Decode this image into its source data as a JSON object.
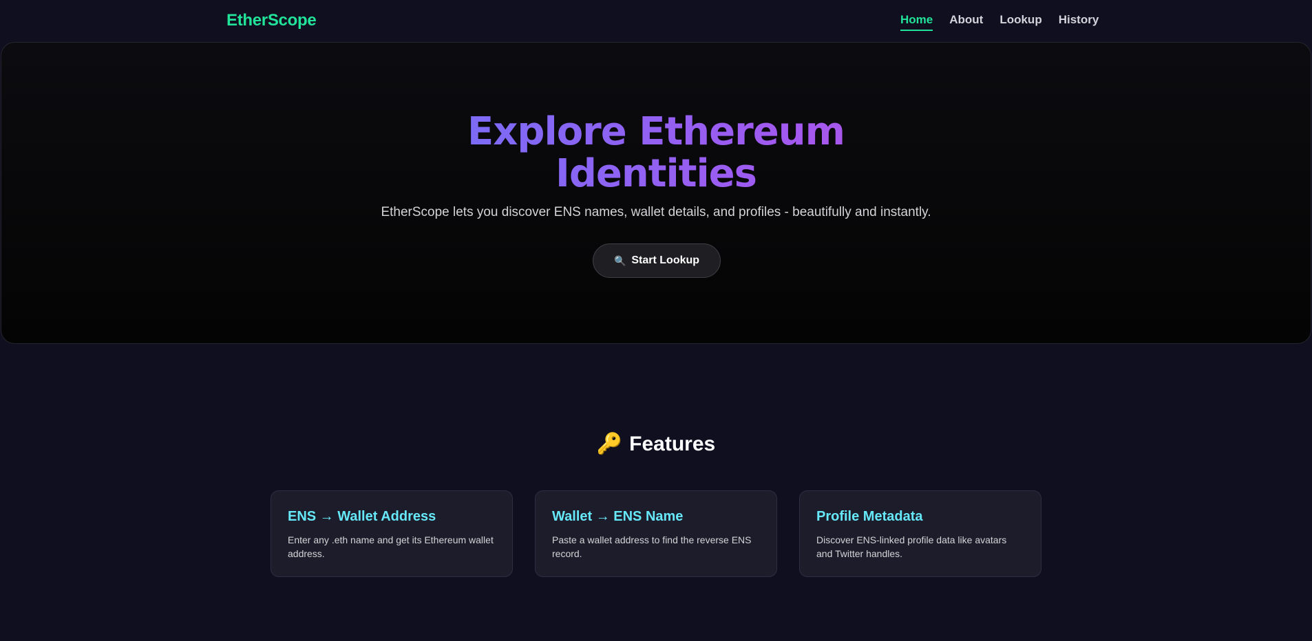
{
  "nav": {
    "logo": "EtherScope",
    "links": [
      "Home",
      "About",
      "Lookup",
      "History"
    ],
    "active": "Home"
  },
  "hero": {
    "title": "Explore Ethereum Identities",
    "subtitle": "EtherScope lets you discover ENS names, wallet details, and profiles - beautifully and instantly.",
    "button_label": "Start Lookup",
    "button_icon": "magnifier-icon"
  },
  "features": {
    "heading": "Features",
    "heading_icon": "key-icon",
    "cards": [
      {
        "title": "ENS → Wallet Address",
        "description": "Enter any .eth name and get its Ethereum wallet address."
      },
      {
        "title": "Wallet → ENS Name",
        "description": "Paste a wallet address to find the reverse ENS record."
      },
      {
        "title": "Profile Metadata",
        "description": "Discover ENS-linked profile data like avatars and Twitter handles."
      }
    ]
  },
  "colors": {
    "accent": "#22e39a",
    "card_title": "#67e8f9",
    "background": "#0f0f1f"
  }
}
